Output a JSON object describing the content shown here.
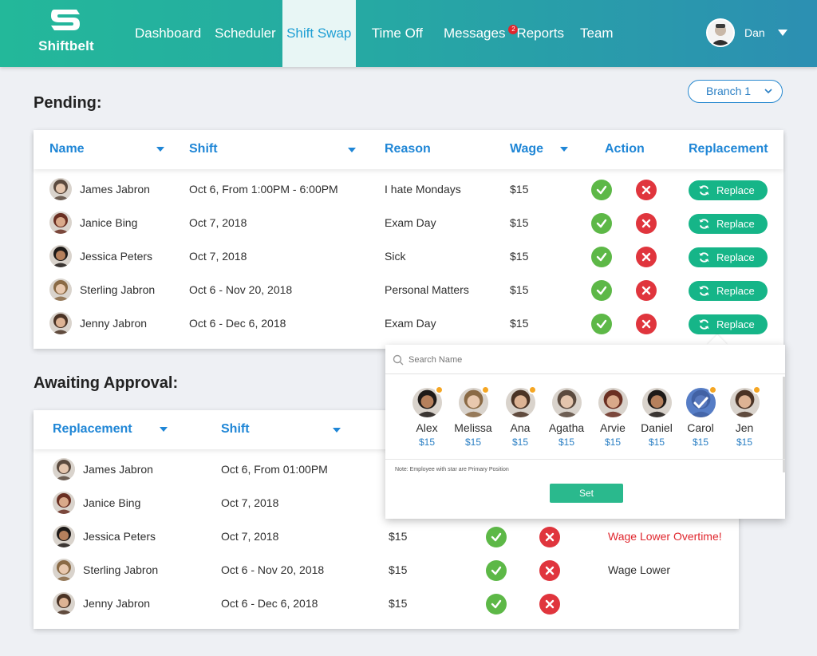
{
  "app": {
    "name": "Shiftbelt"
  },
  "nav": {
    "items": [
      "Dashboard",
      "Scheduler",
      "Shift Swap",
      "Time Off",
      "Messages",
      "Reports",
      "Team"
    ],
    "active": "Shift Swap",
    "messages_badge": "2"
  },
  "user": {
    "name": "Dan"
  },
  "branch": {
    "selected": "Branch 1"
  },
  "pending": {
    "title": "Pending:",
    "headers": {
      "name": "Name",
      "shift": "Shift",
      "reason": "Reason",
      "wage": "Wage",
      "action": "Action",
      "replacement": "Replacement"
    },
    "replace_label": "Replace",
    "rows": [
      {
        "name": "James Jabron",
        "shift": "Oct 6, From 1:00PM - 6:00PM",
        "reason": "I hate Mondays",
        "wage": "$15"
      },
      {
        "name": "Janice Bing",
        "shift": "Oct 7, 2018",
        "reason": "Exam Day",
        "wage": "$15"
      },
      {
        "name": "Jessica Peters",
        "shift": "Oct 7, 2018",
        "reason": "Sick",
        "wage": "$15"
      },
      {
        "name": "Sterling Jabron",
        "shift": "Oct 6 - Nov 20, 2018",
        "reason": "Personal Matters",
        "wage": "$15"
      },
      {
        "name": "Jenny Jabron",
        "shift": "Oct 6 - Dec 6, 2018",
        "reason": "Exam Day",
        "wage": "$15"
      }
    ]
  },
  "awaiting": {
    "title": "Awaiting Approval:",
    "headers": {
      "replacement": "Replacement",
      "shift": "Shift"
    },
    "rows": [
      {
        "name": "James Jabron",
        "shift": "Oct 6, From 01:00PM",
        "wage": "",
        "note": ""
      },
      {
        "name": "Janice Bing",
        "shift": "Oct 7, 2018",
        "wage": "",
        "note": ""
      },
      {
        "name": "Jessica Peters",
        "shift": "Oct 7, 2018",
        "wage": "$15",
        "note": "Wage Lower Overtime!"
      },
      {
        "name": "Sterling Jabron",
        "shift": "Oct 6 - Nov 20, 2018",
        "wage": "$15",
        "note": "Wage Lower"
      },
      {
        "name": "Jenny Jabron",
        "shift": "Oct 6 - Dec 6, 2018",
        "wage": "$15",
        "note": ""
      }
    ]
  },
  "replace_popup": {
    "search_placeholder": "Search Name",
    "employees": [
      {
        "name": "Alex",
        "wage": "$15",
        "primary": true,
        "selected": false
      },
      {
        "name": "Melissa",
        "wage": "$15",
        "primary": true,
        "selected": false
      },
      {
        "name": "Ana",
        "wage": "$15",
        "primary": true,
        "selected": false
      },
      {
        "name": "Agatha",
        "wage": "$15",
        "primary": false,
        "selected": false
      },
      {
        "name": "Arvie",
        "wage": "$15",
        "primary": false,
        "selected": false
      },
      {
        "name": "Daniel",
        "wage": "$15",
        "primary": false,
        "selected": false
      },
      {
        "name": "Carol",
        "wage": "$15",
        "primary": true,
        "selected": true
      },
      {
        "name": "Jen",
        "wage": "$15",
        "primary": true,
        "selected": false
      }
    ],
    "note": "Note: Employee with star are Primary Position",
    "set_label": "Set"
  },
  "colors": {
    "accent": "#1f86d6",
    "approve": "#5db847",
    "reject": "#e0353d",
    "replace": "#16b588",
    "warning": "#e0272e"
  },
  "icons": {
    "approve": "check-icon",
    "reject": "close-icon",
    "replace": "refresh-icon",
    "search": "search-icon",
    "star": "star-icon"
  }
}
